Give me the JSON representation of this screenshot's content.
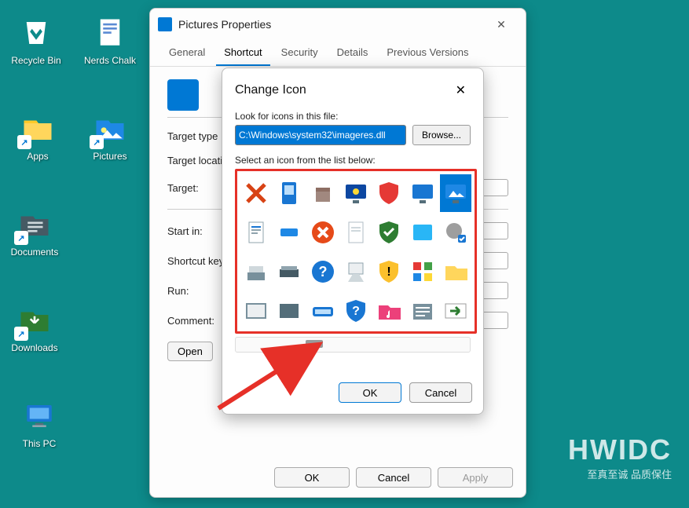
{
  "desktop": {
    "items": [
      {
        "label": "Recycle Bin"
      },
      {
        "label": "Nerds Chalk"
      },
      {
        "label": "Apps"
      },
      {
        "label": "Pictures"
      },
      {
        "label": "Documents"
      },
      {
        "label": "Downloads"
      },
      {
        "label": "This PC"
      }
    ]
  },
  "watermark": {
    "big": "HWIDC",
    "small": "至真至诚 品质保住"
  },
  "properties": {
    "title": "Pictures Properties",
    "tabs": [
      "General",
      "Shortcut",
      "Security",
      "Details",
      "Previous Versions"
    ],
    "active_tab": "Shortcut",
    "fields": {
      "target_type_label": "Target type",
      "target_location_label": "Target location",
      "target_label": "Target:",
      "start_in_label": "Start in:",
      "shortcut_key_label": "Shortcut key",
      "run_label": "Run:",
      "comment_label": "Comment:"
    },
    "open_file_location": "Open",
    "buttons": {
      "ok": "OK",
      "cancel": "Cancel",
      "apply": "Apply"
    }
  },
  "change_icon": {
    "title": "Change Icon",
    "look_label": "Look for icons in this file:",
    "path": "C:\\Windows\\system32\\imageres.dll",
    "browse": "Browse...",
    "select_label": "Select an icon from the list below:",
    "buttons": {
      "ok": "OK",
      "cancel": "Cancel"
    },
    "icons": [
      "red-x",
      "device",
      "box",
      "night-screen",
      "shield-red",
      "monitor",
      "picture-monitor",
      "document",
      "tag",
      "circle-x",
      "document-blank",
      "shield-green",
      "window",
      "gear-check",
      "drive",
      "scanner",
      "help-circle",
      "projector",
      "shield-warn",
      "blocks",
      "folder",
      "frame",
      "frame-dark",
      "run-dialog",
      "shield-help",
      "music-folder",
      "list",
      "arrow-right"
    ],
    "selected_index": 6
  }
}
